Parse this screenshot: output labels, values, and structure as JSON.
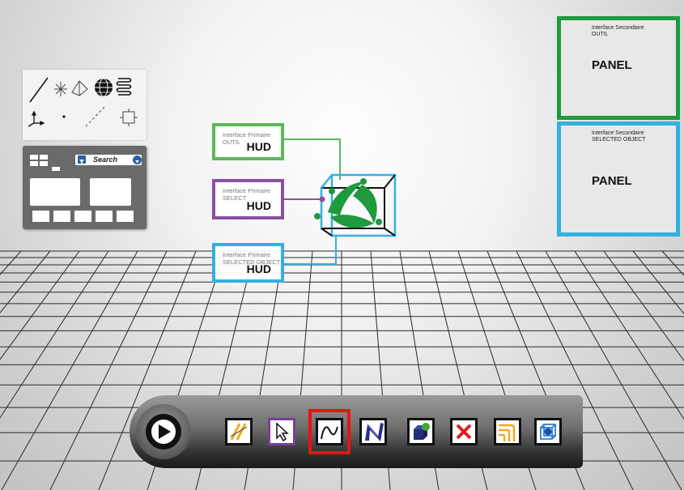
{
  "hud": [
    {
      "subtitle_line1": "Interface Primaire",
      "subtitle_line2": "OUTIL",
      "title": "HUD",
      "color": "#5cb85c"
    },
    {
      "subtitle_line1": "Interface Primaire",
      "subtitle_line2": "SELECT",
      "title": "HUD",
      "color": "#8a4fa0"
    },
    {
      "subtitle_line1": "Interface Primaire",
      "subtitle_line2": "SELECTED OBJECT",
      "title": "HUD",
      "color": "#35b0e0"
    }
  ],
  "panels": [
    {
      "subtitle_line1": "Interface Secondaire",
      "subtitle_line2": "OUTIL",
      "title": "PANEL",
      "color": "#1f9a3f"
    },
    {
      "subtitle_line1": "Interface Secondaire",
      "subtitle_line2": "SELECTED OBJECT",
      "title": "PANEL",
      "color": "#35b0e0"
    }
  ],
  "browser": {
    "search_label": "Search"
  },
  "toolbar": {
    "play_icon": "play-icon",
    "tools": [
      "line-tool-icon",
      "select-arrow-icon",
      "curve-icon",
      "nurbs-icon",
      "solid-object-icon",
      "delete-icon",
      "offset-icon",
      "cube-view-icon"
    ],
    "highlight_color": "#ee1111"
  }
}
